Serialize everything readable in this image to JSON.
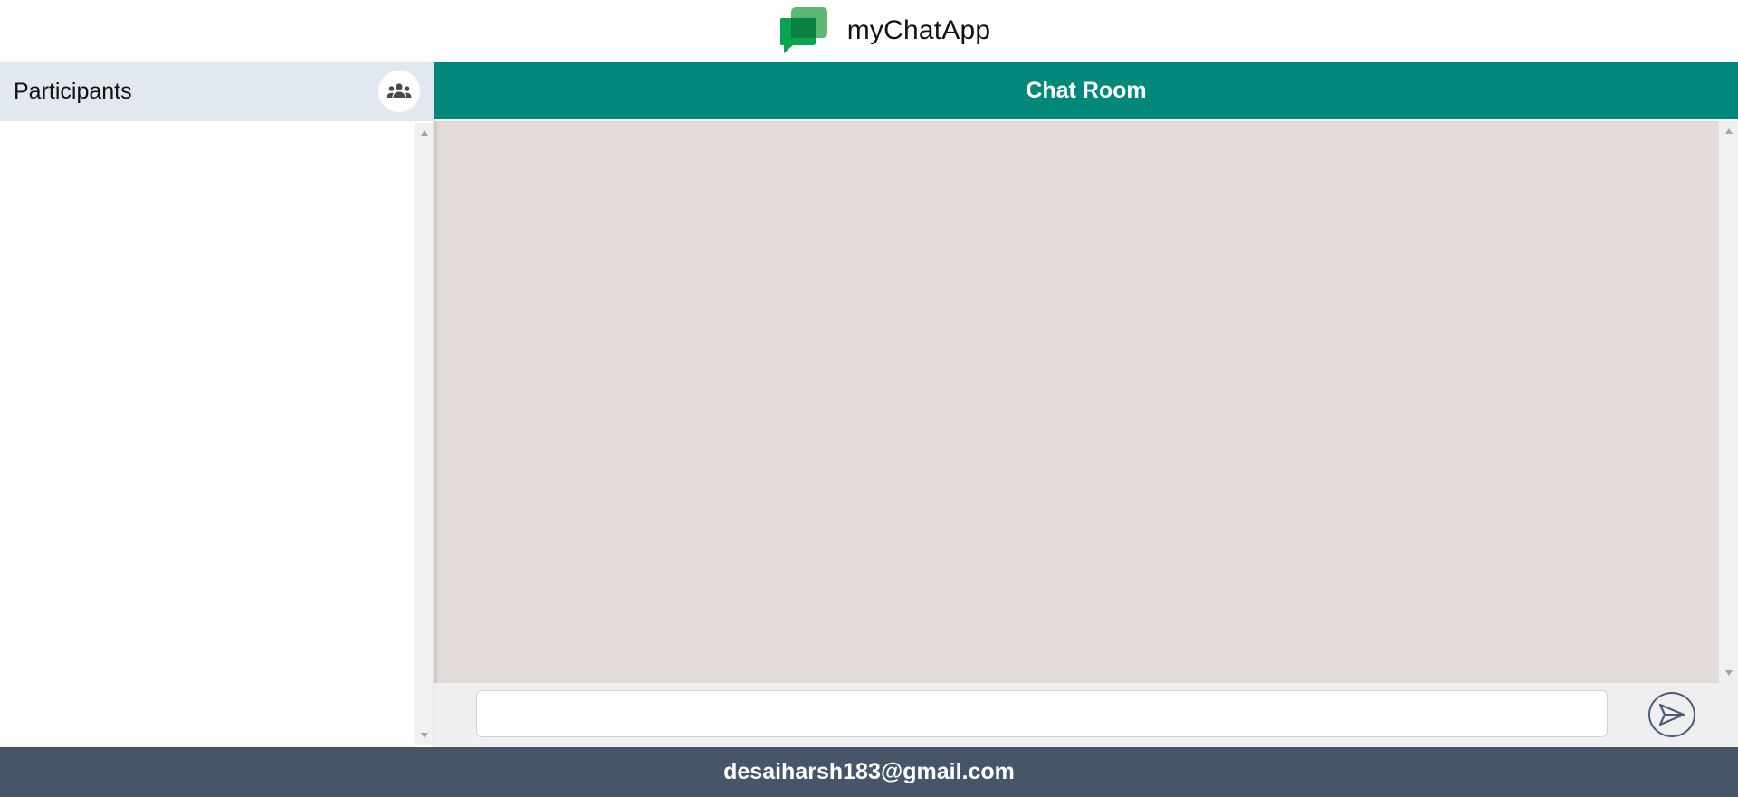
{
  "header": {
    "app_title": "myChatApp",
    "logo_icon": "chat-bubbles-logo-icon",
    "logo_colors": {
      "front": "#0aa34f",
      "back": "#5bb974",
      "overlap": "#0b8043"
    }
  },
  "participants": {
    "title": "Participants",
    "group_icon": "group-icon",
    "items": []
  },
  "chat": {
    "title": "Chat Room",
    "header_color": "#00897b",
    "messages": [],
    "input_value": "",
    "input_placeholder": "",
    "send_icon": "send-icon"
  },
  "footer": {
    "user_email": "desaiharsh183@gmail.com",
    "color": "#475569"
  }
}
